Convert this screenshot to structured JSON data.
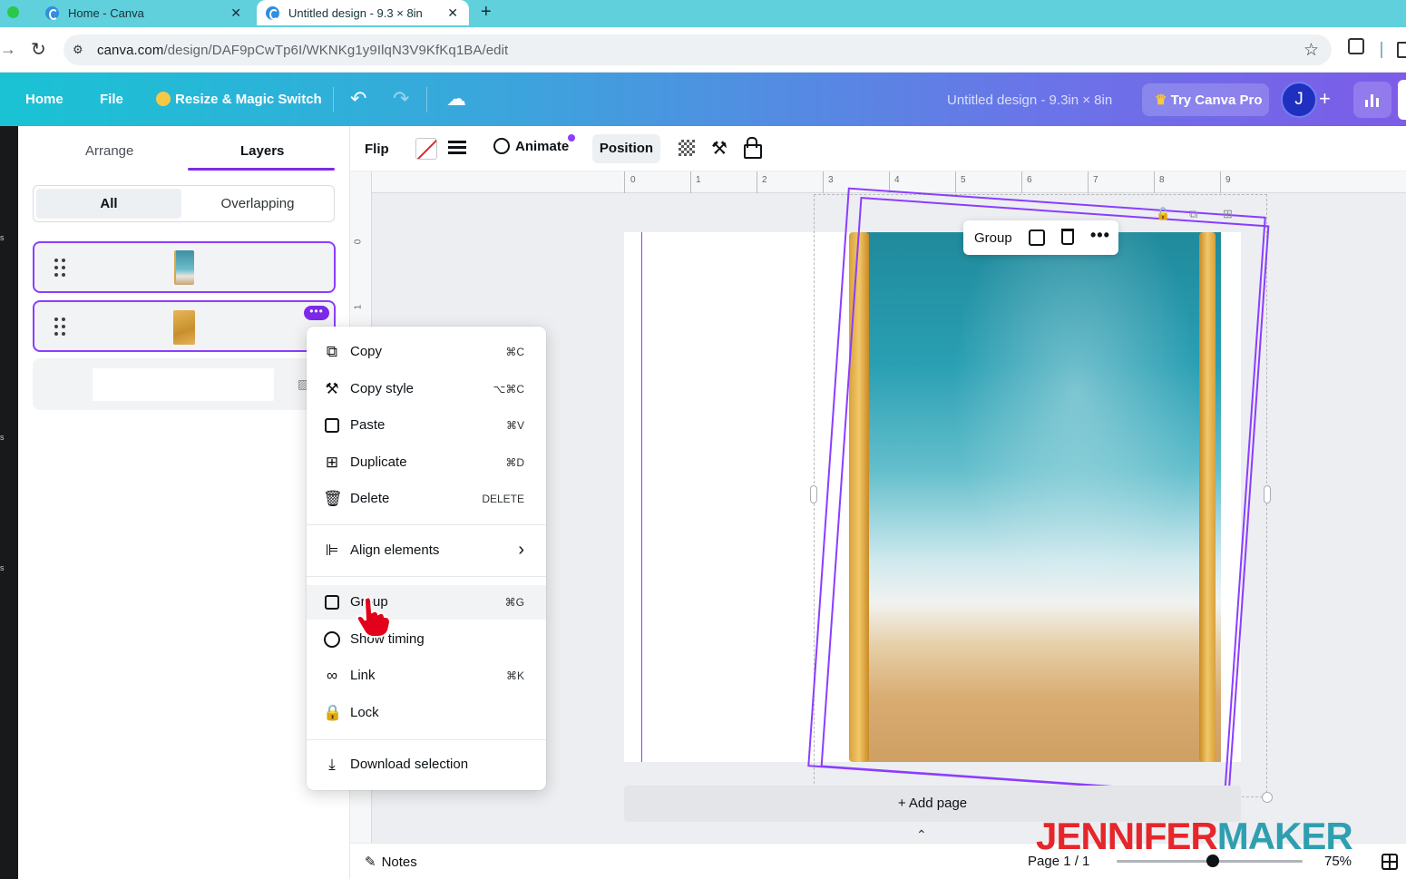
{
  "browser": {
    "tabs": [
      {
        "label": "Home - Canva"
      },
      {
        "label": "Untitled design - 9.3 × 8in"
      }
    ],
    "url_domain": "canva.com",
    "url_path": "/design/DAF9pCwTp6I/WKNKg1y9IlqN3V9KfKq1BA/edit"
  },
  "header": {
    "home": "Home",
    "file": "File",
    "resize": "Resize & Magic Switch",
    "doc_title": "Untitled design - 9.3in × 8in",
    "pro": "Try Canva Pro",
    "avatar_letter": "J",
    "plus": "+"
  },
  "left_rail": [
    "s",
    "s",
    "s"
  ],
  "panel": {
    "tabs": [
      "Arrange",
      "Layers"
    ],
    "active_tab": "Layers",
    "filter": {
      "all": "All",
      "overlapping": "Overlapping"
    },
    "more_dots": "•••"
  },
  "toolbar": {
    "flip": "Flip",
    "animate": "Animate",
    "position": "Position"
  },
  "ruler": {
    "top": [
      "0",
      "1",
      "2",
      "3",
      "4",
      "5",
      "6",
      "7",
      "8",
      "9"
    ],
    "left": [
      "0",
      "1"
    ]
  },
  "group_popover": {
    "label": "Group",
    "more": "•••"
  },
  "context_menu": {
    "items": [
      {
        "label": "Copy",
        "shortcut": "⌘C",
        "icon": "copy-icon"
      },
      {
        "label": "Copy style",
        "shortcut": "⌥⌘C",
        "icon": "paint-roller-icon"
      },
      {
        "label": "Paste",
        "shortcut": "⌘V",
        "icon": "clipboard-icon"
      },
      {
        "label": "Duplicate",
        "shortcut": "⌘D",
        "icon": "duplicate-icon"
      },
      {
        "label": "Delete",
        "shortcut": "DELETE",
        "icon": "trash-icon"
      },
      {
        "label": "Align elements",
        "shortcut": "",
        "icon": "align-icon"
      },
      {
        "label": "Group",
        "shortcut": "⌘G",
        "icon": "group-icon"
      },
      {
        "label": "Show timing",
        "shortcut": "",
        "icon": "clock-icon"
      },
      {
        "label": "Link",
        "shortcut": "⌘K",
        "icon": "link-icon"
      },
      {
        "label": "Lock",
        "shortcut": "",
        "icon": "lock-icon"
      },
      {
        "label": "Download selection",
        "shortcut": "",
        "icon": "download-icon"
      }
    ]
  },
  "canvas": {
    "add_page": "+ Add page"
  },
  "footer": {
    "notes": "Notes",
    "page": "Page 1 / 1",
    "zoom": "75%",
    "zoom_level_percent": 75
  },
  "watermark": {
    "part1": "JENNIFER",
    "part2": "MAKER"
  },
  "colors": {
    "accent": "#8b3dff",
    "header_gradient_start": "#19c3d4",
    "header_gradient_end": "#7c5ce8"
  }
}
